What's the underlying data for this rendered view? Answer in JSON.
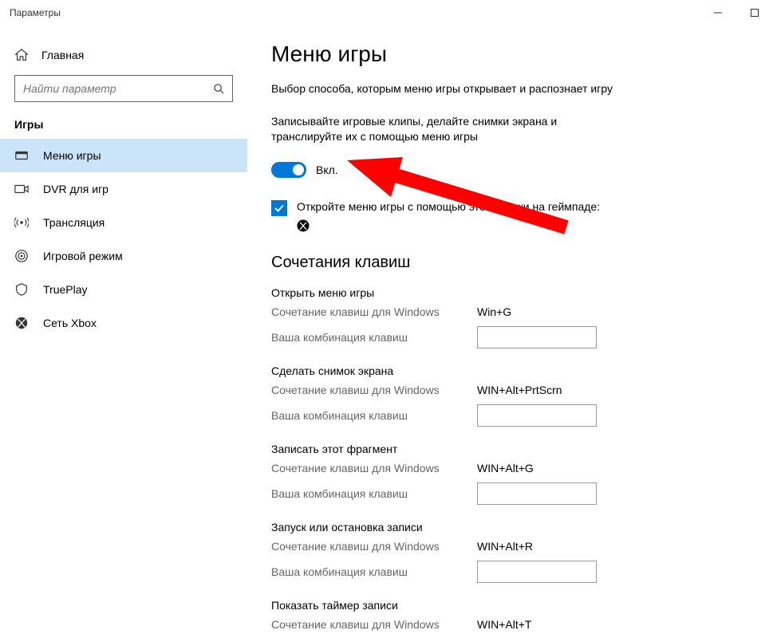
{
  "window": {
    "title": "Параметры"
  },
  "sidebar": {
    "home": "Главная",
    "search_placeholder": "Найти параметр",
    "category": "Игры",
    "items": [
      {
        "label": "Меню игры"
      },
      {
        "label": "DVR для игр"
      },
      {
        "label": "Трансляция"
      },
      {
        "label": "Игровой режим"
      },
      {
        "label": "TruePlay"
      },
      {
        "label": "Сеть Xbox"
      }
    ]
  },
  "content": {
    "heading": "Меню игры",
    "desc1": "Выбор способа, которым меню игры открывает и распознает игру",
    "desc2": "Записывайте игровые клипы, делайте снимки экрана и транслируйте их с помощью меню игры",
    "toggle_label": "Вкл.",
    "checkbox_label": "Откройте меню игры с помощью этой кнопки на геймпаде:",
    "shortcuts_heading": "Сочетания клавиш",
    "win_shortcut_label": "Сочетание клавиш для Windows",
    "user_shortcut_label": "Ваша комбинация клавиш",
    "shortcuts": [
      {
        "title": "Открыть меню игры",
        "win": "Win+G"
      },
      {
        "title": "Сделать снимок экрана",
        "win": "WIN+Alt+PrtScrn"
      },
      {
        "title": "Записать этот фрагмент",
        "win": "WIN+Alt+G"
      },
      {
        "title": "Запуск или остановка записи",
        "win": "WIN+Alt+R"
      },
      {
        "title": "Показать таймер записи",
        "win": "WIN+Alt+T"
      }
    ]
  }
}
